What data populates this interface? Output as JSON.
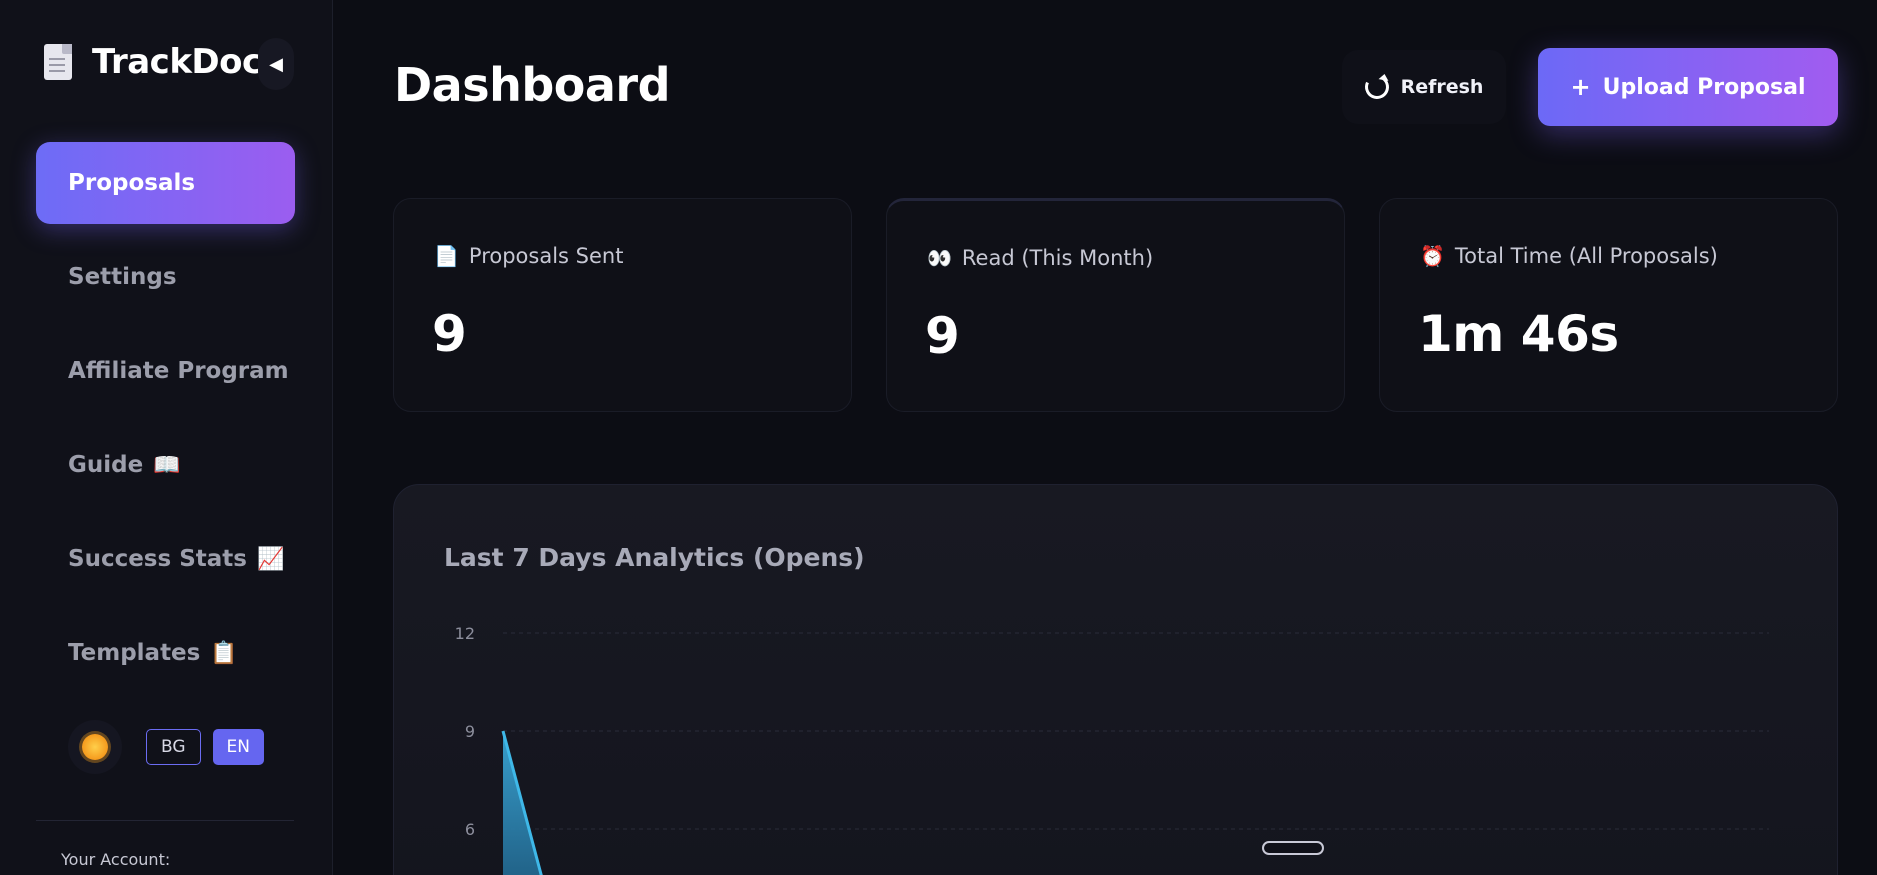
{
  "brand": {
    "title": "TrackDoc",
    "collapse_glyph": "◀"
  },
  "sidebar": {
    "items": [
      {
        "label": "Proposals",
        "emoji": ""
      },
      {
        "label": "Settings",
        "emoji": ""
      },
      {
        "label": "Affiliate Program",
        "emoji": ""
      },
      {
        "label": "Guide",
        "emoji": "📖"
      },
      {
        "label": "Success Stats",
        "emoji": "📈"
      },
      {
        "label": "Templates",
        "emoji": "📋"
      }
    ],
    "active_index": 0,
    "languages": [
      "BG",
      "EN"
    ],
    "active_language": "EN",
    "account_label": "Your Account:"
  },
  "header": {
    "title": "Dashboard",
    "refresh_label": "Refresh",
    "upload_label": "Upload Proposal",
    "upload_plus": "+"
  },
  "stats": [
    {
      "icon": "📄",
      "label": "Proposals Sent",
      "value": "9"
    },
    {
      "icon": "👀",
      "label": "Read (This Month)",
      "value": "9"
    },
    {
      "icon": "⏰",
      "label": "Total Time (All Proposals)",
      "value": "1m 46s"
    }
  ],
  "chart": {
    "title": "Last 7 Days Analytics (Opens)"
  },
  "chart_data": {
    "type": "area",
    "title": "Last 7 Days Analytics (Opens)",
    "y_ticks": [
      12,
      9,
      6
    ],
    "ylim": [
      0,
      12
    ],
    "grid": true,
    "series": [
      {
        "values": [
          9,
          0
        ]
      }
    ],
    "colors": {
      "series": "#3fb8e8",
      "grid": "#2a2c3a"
    }
  },
  "colors": {
    "accent_start": "#6c69f6",
    "accent_end": "#a15cf0",
    "background": "#0c0d14",
    "sidebar": "#101119"
  }
}
